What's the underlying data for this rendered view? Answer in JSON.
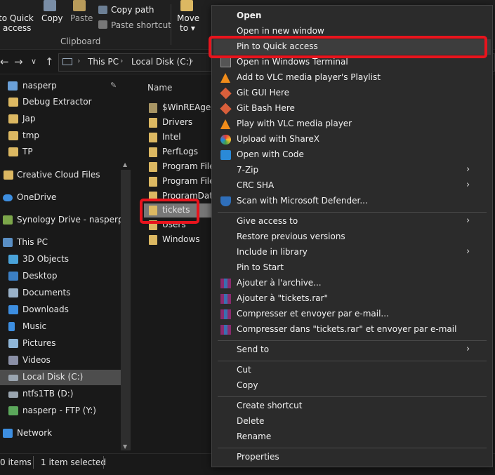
{
  "ribbon": {
    "pin_quick_access": "Pin to Quick access",
    "copy": "Copy",
    "paste": "Paste",
    "copy_path": "Copy path",
    "paste_shortcut": "Paste shortcut",
    "move_to": "Move to",
    "clipboard": "Clipboard"
  },
  "address": {
    "back": "←",
    "forward": "→",
    "chevron": "∨",
    "up": "↑",
    "crumbs": [
      "This PC",
      "Local Disk (C:)"
    ]
  },
  "nav": {
    "pinned": [
      "nasperp",
      "Debug Extractor",
      "Jap",
      "tmp",
      "TP"
    ],
    "items": [
      "Creative Cloud Files",
      "OneDrive",
      "Synology Drive - nasperp",
      "This PC",
      "3D Objects",
      "Desktop",
      "Documents",
      "Downloads",
      "Music",
      "Pictures",
      "Videos",
      "Local Disk (C:)",
      "ntfs1TB (D:)",
      "nasperp - FTP (Y:)",
      "Network"
    ]
  },
  "files": {
    "header_name": "Name",
    "rows": [
      "$WinREAgent",
      "Drivers",
      "Intel",
      "PerfLogs",
      "Program Files",
      "Program Files",
      "ProgramData",
      "tickets",
      "Users",
      "Windows"
    ],
    "selected": "tickets"
  },
  "status": {
    "items_count": "0 items",
    "selected_text": "1 item selected"
  },
  "context_menu": {
    "items": [
      "Open",
      "Open in new window",
      "Pin to Quick access",
      "Open in Windows Terminal",
      "Add to VLC media player's Playlist",
      "Git GUI Here",
      "Git Bash Here",
      "Play with VLC media player",
      "Upload with ShareX",
      "Open with Code",
      "7-Zip",
      "CRC SHA",
      "Scan with Microsoft Defender...",
      "Give access to",
      "Restore previous versions",
      "Include in library",
      "Pin to Start",
      "Ajouter à l'archive...",
      "Ajouter à \"tickets.rar\"",
      "Compresser et envoyer par e-mail...",
      "Compresser dans \"tickets.rar\" et envoyer par e-mail",
      "Send to",
      "Cut",
      "Copy",
      "Create shortcut",
      "Delete",
      "Rename",
      "Properties"
    ],
    "highlighted": "Pin to Quick access",
    "submenu_arrow": "›"
  },
  "colors": {
    "highlight_box": "#e8141d",
    "folder": "#dcb862",
    "selection": "#777777"
  }
}
